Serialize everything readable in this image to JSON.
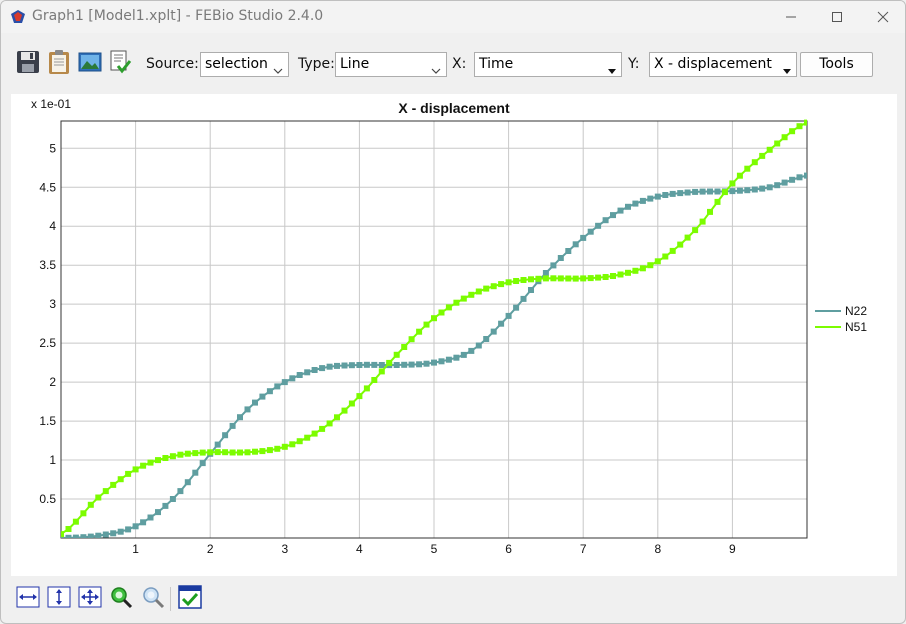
{
  "window": {
    "title": "Graph1 [Model1.xplt] - FEBio Studio 2.4.0"
  },
  "toolbar": {
    "icons": [
      "save-icon",
      "clipboard-icon",
      "image-icon",
      "export-icon"
    ],
    "source_label": "Source:",
    "source_value": "selection",
    "type_label": "Type:",
    "type_value": "Line",
    "x_label": "X:",
    "x_value": "Time",
    "y_label": "Y:",
    "y_value": "X - displacement",
    "tools_label": "Tools"
  },
  "bottombar": {
    "icons": [
      "zoom-width-icon",
      "zoom-height-icon",
      "zoom-fit-icon",
      "zoom-region-icon",
      "zoom-search-icon",
      "checkbox-icon"
    ]
  },
  "colors": {
    "N22": "#5f9ea0",
    "N51": "#7cfc00"
  },
  "chart_data": {
    "type": "line",
    "title": "X - displacement",
    "scale_label": "x 1e-01",
    "xlabel": "",
    "ylabel": "",
    "xlim": [
      0,
      10
    ],
    "ylim": [
      0,
      5.35
    ],
    "xticks": [
      "1",
      "2",
      "3",
      "4",
      "5",
      "6",
      "7",
      "8",
      "9"
    ],
    "yticks": [
      "0.5",
      "1",
      "1.5",
      "2",
      "2.5",
      "3",
      "3.5",
      "4",
      "4.5",
      "5"
    ],
    "grid": true,
    "legend": "right",
    "markers": "square",
    "series": [
      {
        "name": "N22",
        "x": [
          0,
          0.5,
          1,
          1.5,
          2,
          2.5,
          3,
          3.5,
          4,
          4.5,
          5,
          5.5,
          6,
          6.5,
          7,
          7.5,
          8,
          8.5,
          9,
          9.5,
          10
        ],
        "values": [
          0,
          0.03,
          0.15,
          0.5,
          1.08,
          1.65,
          2,
          2.18,
          2.22,
          2.22,
          2.25,
          2.4,
          2.85,
          3.4,
          3.85,
          4.2,
          4.38,
          4.44,
          4.45,
          4.5,
          4.65
        ]
      },
      {
        "name": "N51",
        "x": [
          0,
          0.5,
          1,
          1.5,
          2,
          2.5,
          3,
          3.5,
          4,
          4.5,
          5,
          5.5,
          6,
          6.5,
          7,
          7.5,
          8,
          8.5,
          9,
          9.5,
          10
        ],
        "values": [
          0.05,
          0.52,
          0.88,
          1.05,
          1.1,
          1.1,
          1.17,
          1.4,
          1.82,
          2.35,
          2.82,
          3.12,
          3.28,
          3.33,
          3.33,
          3.38,
          3.55,
          3.95,
          4.55,
          4.98,
          5.33
        ]
      }
    ]
  }
}
